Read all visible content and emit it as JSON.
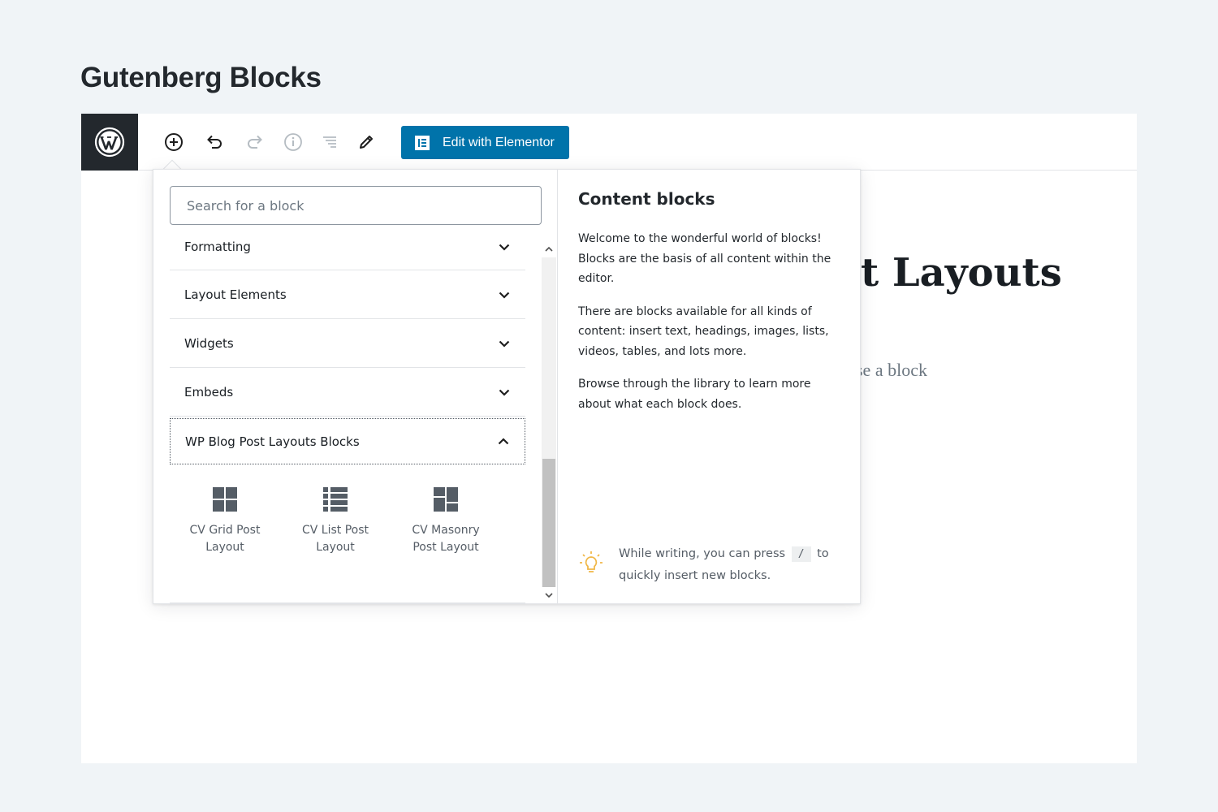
{
  "page": {
    "heading": "Gutenberg Blocks"
  },
  "toolbar": {
    "icons": [
      "wordpress-icon",
      "add-block-icon",
      "undo-icon",
      "redo-icon",
      "info-icon",
      "outline-icon",
      "edit-icon"
    ],
    "elementor_button": "Edit with Elementor",
    "accent_color": "#0073aa"
  },
  "background": {
    "title_fragment": "t Layouts",
    "hint_fragment": "se a block"
  },
  "inserter": {
    "search": {
      "placeholder": "Search for a block",
      "value": ""
    },
    "panels": [
      {
        "label": "Formatting",
        "state": "collapsed"
      },
      {
        "label": "Layout Elements",
        "state": "collapsed"
      },
      {
        "label": "Widgets",
        "state": "collapsed"
      },
      {
        "label": "Embeds",
        "state": "collapsed"
      },
      {
        "label": "WP Blog Post Layouts Blocks",
        "state": "expanded"
      }
    ],
    "blocks": [
      {
        "line1": "CV Grid Post",
        "line2": "Layout",
        "icon": "grid-icon"
      },
      {
        "line1": "CV List Post",
        "line2": "Layout",
        "icon": "list-icon"
      },
      {
        "line1": "CV Masonry",
        "line2": "Post Layout",
        "icon": "masonry-icon"
      }
    ],
    "help": {
      "title": "Content blocks",
      "paragraphs": [
        "Welcome to the wonderful world of blocks! Blocks are the basis of all content within the editor.",
        "There are blocks available for all kinds of content: insert text, headings, images, lists, videos, tables, and lots more.",
        "Browse through the library to learn more about what each block does."
      ],
      "tip_before": "While writing, you can press",
      "tip_key": "/",
      "tip_after": "to quickly insert new blocks."
    }
  }
}
